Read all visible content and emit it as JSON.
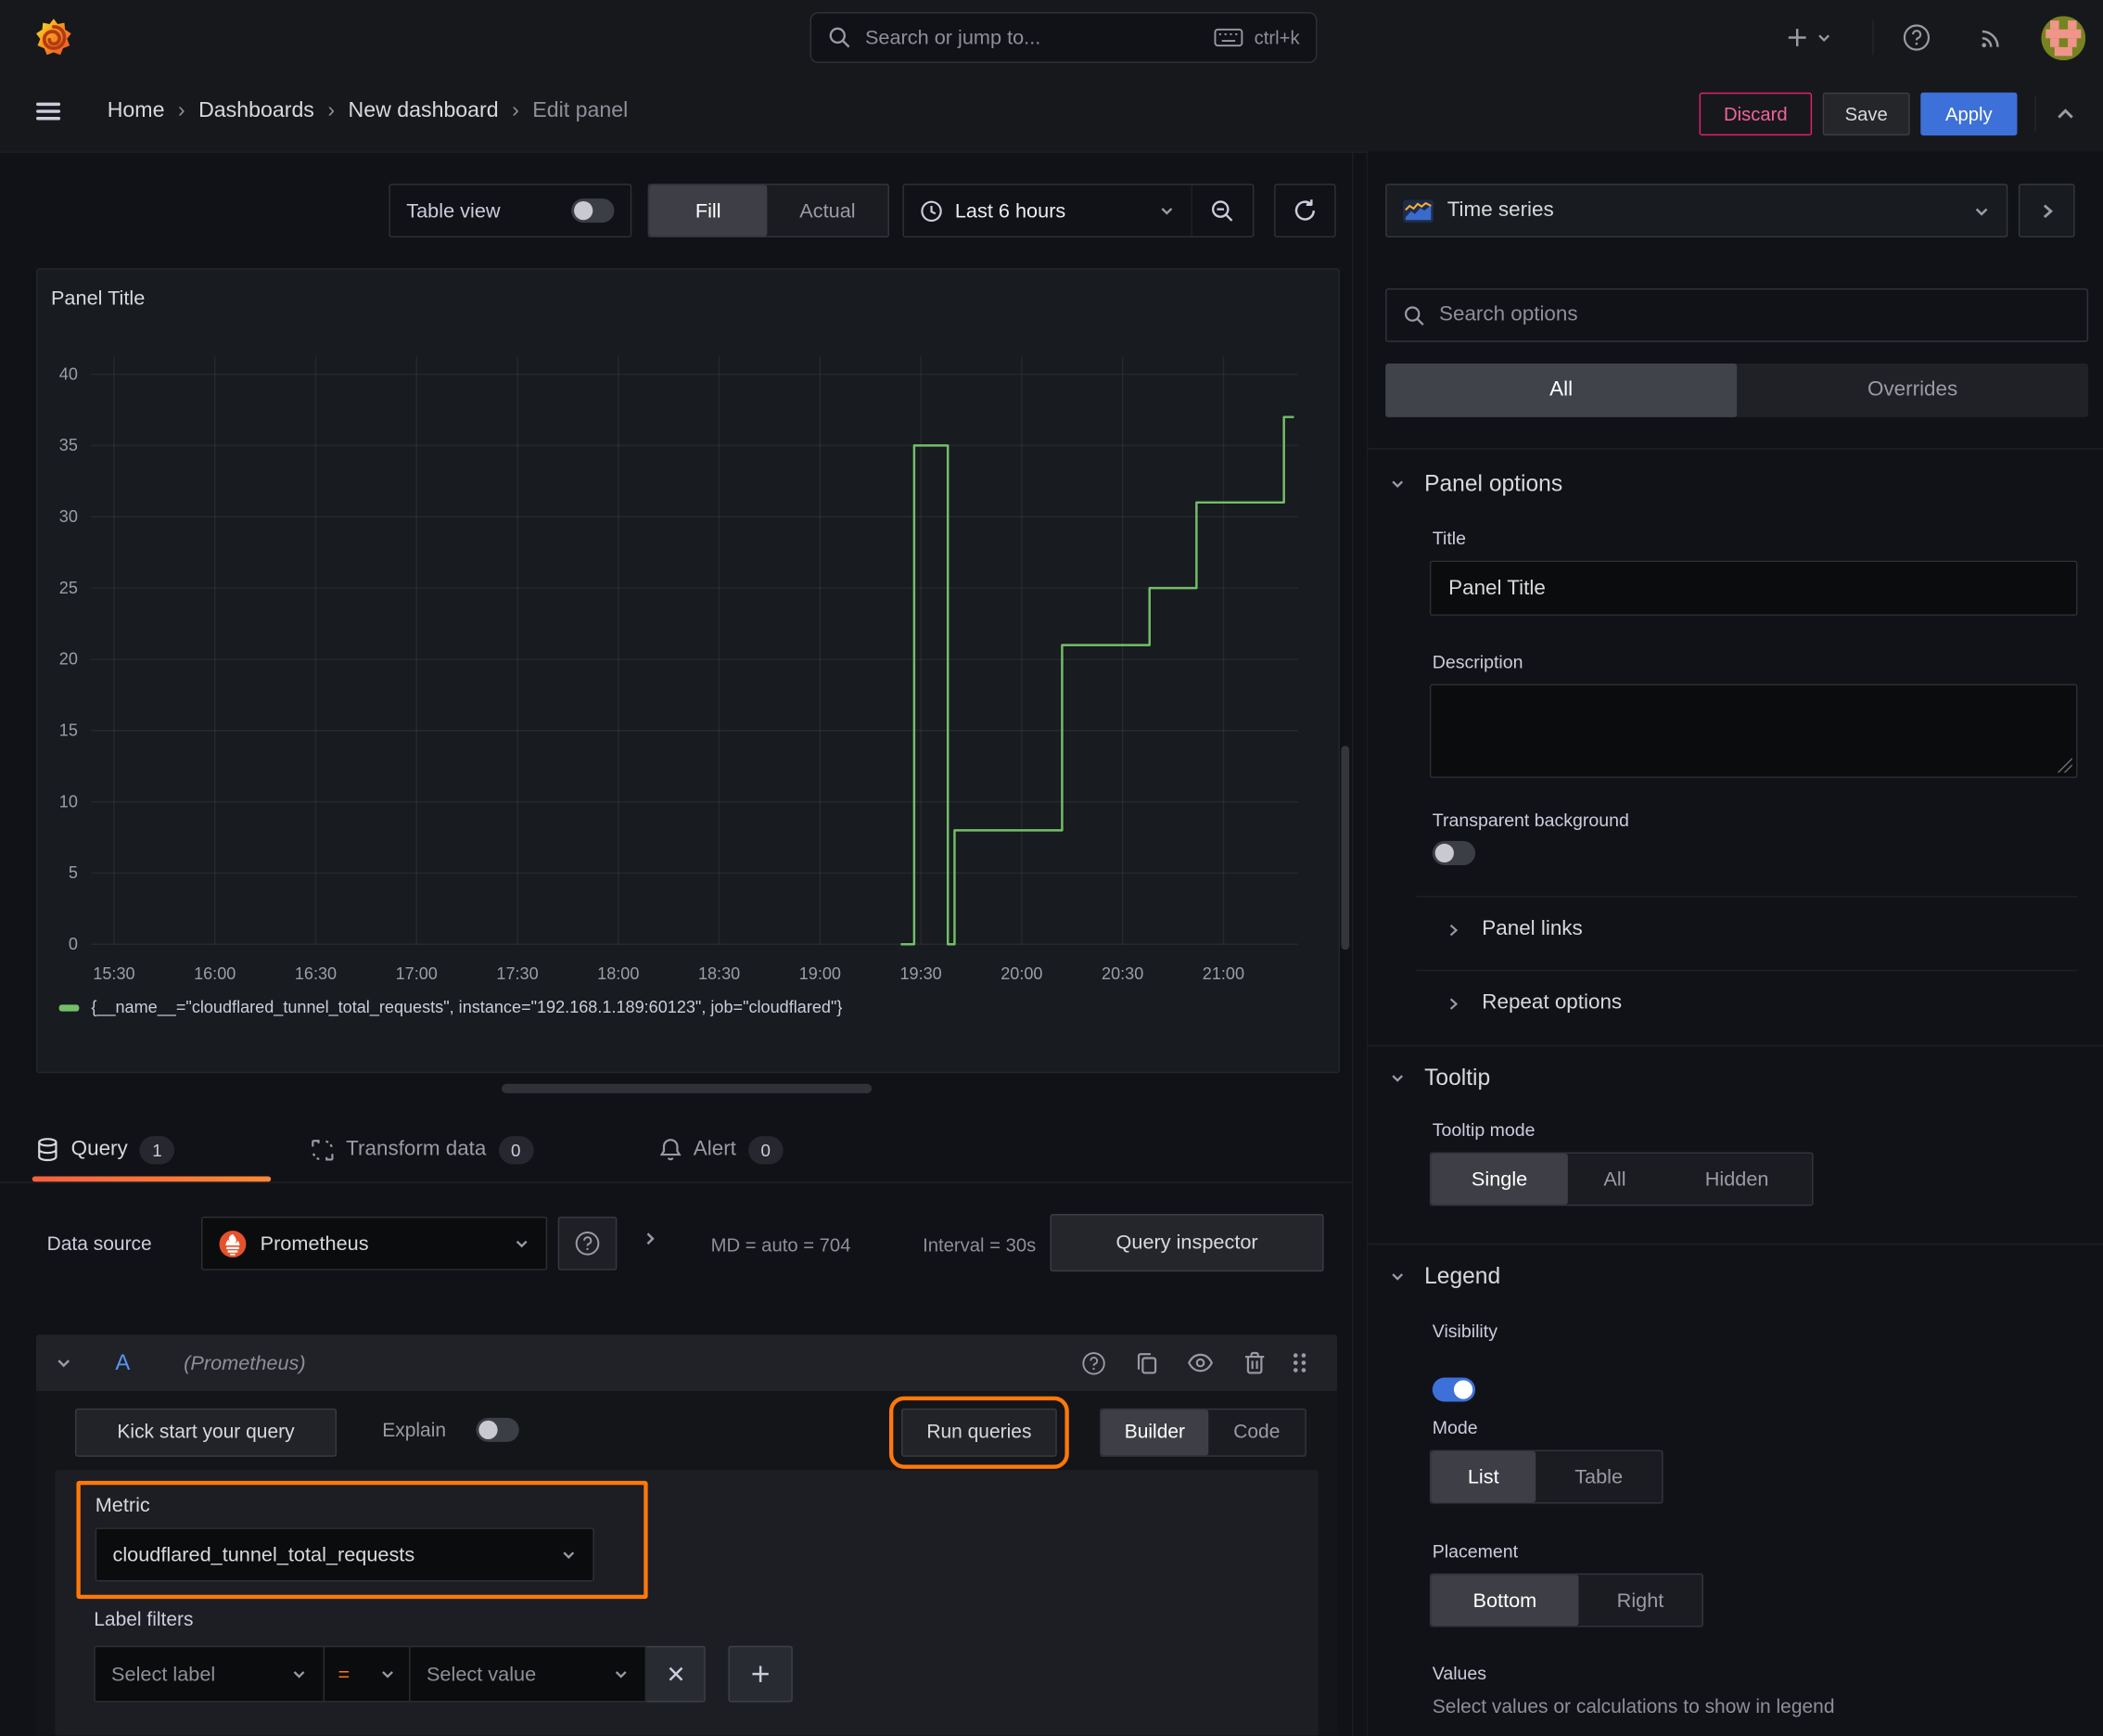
{
  "topbar": {
    "search_placeholder": "Search or jump to...",
    "shortcut": "ctrl+k"
  },
  "breadcrumb": {
    "items": [
      "Home",
      "Dashboards",
      "New dashboard",
      "Edit panel"
    ]
  },
  "actions": {
    "discard": "Discard",
    "save": "Save",
    "apply": "Apply"
  },
  "panel_toolbar": {
    "table_view_label": "Table view",
    "fill_label": "Fill",
    "actual_label": "Actual",
    "time_range": "Last 6 hours"
  },
  "panel": {
    "title": "Panel Title"
  },
  "chart_data": {
    "type": "line",
    "step": true,
    "title": "Panel Title",
    "xlabel": "",
    "ylabel": "",
    "ylim": [
      0,
      40
    ],
    "grid": true,
    "legend_position": "bottom",
    "x_ticks": [
      "15:30",
      "16:00",
      "16:30",
      "17:00",
      "17:30",
      "18:00",
      "18:30",
      "19:00",
      "19:30",
      "20:00",
      "20:30",
      "21:00"
    ],
    "y_ticks": [
      0,
      5,
      10,
      15,
      20,
      25,
      30,
      35,
      40
    ],
    "x_range": [
      "15:26",
      "21:21"
    ],
    "series": [
      {
        "name": "{__name__=\"cloudflared_tunnel_total_requests\", instance=\"192.168.1.189:60123\", job=\"cloudflared\"}",
        "color": "#73BF69",
        "points": [
          [
            "19:24",
            0
          ],
          [
            "19:28",
            35
          ],
          [
            "19:38",
            0
          ],
          [
            "19:40",
            8
          ],
          [
            "20:12",
            21
          ],
          [
            "20:38",
            25
          ],
          [
            "20:52",
            31
          ],
          [
            "21:18",
            37
          ],
          [
            "21:21",
            37
          ]
        ]
      }
    ]
  },
  "tabs": {
    "query": {
      "label": "Query",
      "count": "1"
    },
    "transform": {
      "label": "Transform data",
      "count": "0"
    },
    "alert": {
      "label": "Alert",
      "count": "0"
    }
  },
  "datasource_row": {
    "label": "Data source",
    "value": "Prometheus",
    "stats_md": "MD = auto = 704",
    "stats_interval": "Interval = 30s",
    "inspector": "Query inspector"
  },
  "query_a": {
    "ref_id": "A",
    "datasource_hint": "(Prometheus)",
    "kickstart": "Kick start your query",
    "explain": "Explain",
    "run_queries": "Run queries",
    "builder": "Builder",
    "code": "Code",
    "metric_label": "Metric",
    "metric_value": "cloudflared_tunnel_total_requests",
    "label_filters": "Label filters",
    "select_label_placeholder": "Select label",
    "operator": "=",
    "select_value_placeholder": "Select value"
  },
  "sidebar": {
    "visualization": "Time series",
    "search_placeholder": "Search options",
    "tabs": {
      "all": "All",
      "overrides": "Overrides"
    },
    "panel_options": {
      "title": "Panel options",
      "title_label": "Title",
      "title_value": "Panel Title",
      "description_label": "Description",
      "transparent_label": "Transparent background"
    },
    "panel_links": "Panel links",
    "repeat_options": "Repeat options",
    "tooltip": {
      "title": "Tooltip",
      "mode_label": "Tooltip mode",
      "options": [
        "Single",
        "All",
        "Hidden"
      ],
      "selected": "Single"
    },
    "legend": {
      "title": "Legend",
      "visibility_label": "Visibility",
      "mode_label": "Mode",
      "mode_options": [
        "List",
        "Table"
      ],
      "mode_selected": "List",
      "placement_label": "Placement",
      "placement_options": [
        "Bottom",
        "Right"
      ],
      "placement_selected": "Bottom",
      "values_label": "Values",
      "values_hint": "Select values or calculations to show in legend"
    }
  },
  "colors": {
    "accent_blue": "#3D71D9",
    "accent_orange": "#FF780A",
    "danger_pink": "#E0226E",
    "series_green": "#73BF69",
    "panel_bg": "#181B1F",
    "page_bg": "#111217"
  }
}
